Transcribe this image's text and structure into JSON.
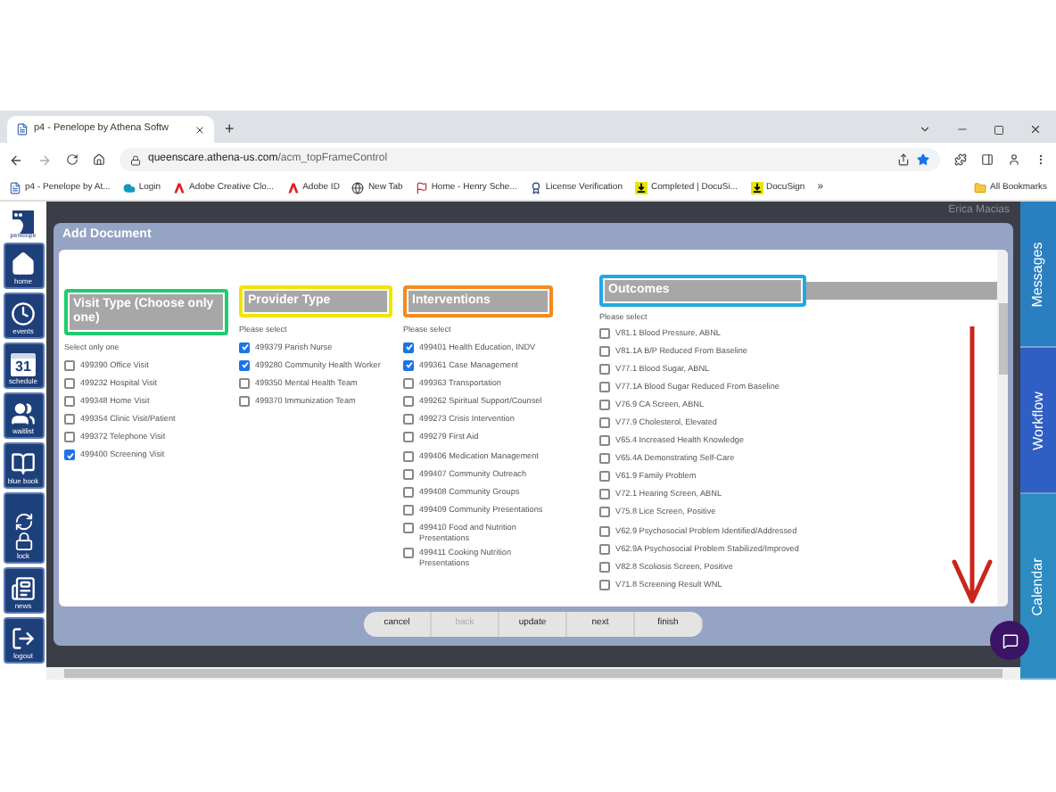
{
  "browser": {
    "tab_title": "p4 - Penelope by Athena Softw",
    "new_tab": "+",
    "address_host": "queenscare.athena-us.com",
    "address_path": "/acm_topFrameControl",
    "bookmarks": [
      {
        "label": "p4 - Penelope by At...",
        "kind": "page"
      },
      {
        "label": "Login",
        "kind": "cloud"
      },
      {
        "label": "Adobe Creative Clo...",
        "kind": "adobe"
      },
      {
        "label": "Adobe ID",
        "kind": "adobe"
      },
      {
        "label": "New Tab",
        "kind": "globe"
      },
      {
        "label": "Home - Henry Sche...",
        "kind": "flag"
      },
      {
        "label": "License Verification",
        "kind": "seal"
      },
      {
        "label": "Completed | DocuSi...",
        "kind": "download"
      },
      {
        "label": "DocuSign",
        "kind": "download"
      }
    ],
    "more": "»",
    "all_bookmarks": "All Bookmarks"
  },
  "sidebar": {
    "logo_label": "penelope",
    "items": [
      {
        "label": "home",
        "kind": "home"
      },
      {
        "label": "events",
        "kind": "clock"
      },
      {
        "label": "schedule",
        "kind": "calendar",
        "badge": "31"
      },
      {
        "label": "waitlist",
        "kind": "people"
      },
      {
        "label": "blue book",
        "kind": "book"
      },
      {
        "label": "lock",
        "kind": "lock"
      },
      {
        "label": "news",
        "kind": "news"
      },
      {
        "label": "logout",
        "kind": "logout"
      }
    ]
  },
  "user_name": "Erica Macias",
  "dialog": {
    "title": "Add Document",
    "sections": [
      {
        "title": "Visit Type (Choose only one)",
        "color": "#1fcc6e",
        "hint": "Select only one",
        "items": [
          {
            "label": "499390 Office Visit",
            "checked": false
          },
          {
            "label": "499232 Hospital Visit",
            "checked": false
          },
          {
            "label": "499348 Home Visit",
            "checked": false
          },
          {
            "label": "499354 Clinic Visit/Patient",
            "checked": false
          },
          {
            "label": "499372 Telephone Visit",
            "checked": false
          },
          {
            "label": "499400 Screening Visit",
            "checked": true
          }
        ]
      },
      {
        "title": "Provider Type",
        "color": "#f2e400",
        "hint": "Please select",
        "items": [
          {
            "label": "499379 Parish Nurse",
            "checked": true
          },
          {
            "label": "499280 Community Health Worker",
            "checked": true
          },
          {
            "label": "499350 Mental Health Team",
            "checked": false
          },
          {
            "label": "499370 Immunization Team",
            "checked": false
          }
        ]
      },
      {
        "title": "Interventions",
        "color": "#f38b1e",
        "hint": "Please select",
        "items": [
          {
            "label": "499401 Health Education, INDV",
            "checked": true
          },
          {
            "label": "499361 Case Management",
            "checked": true
          },
          {
            "label": "499363 Transportation",
            "checked": false
          },
          {
            "label": "499262 Spiritual Support/Counsel",
            "checked": false
          },
          {
            "label": "499273 Crisis Intervention",
            "checked": false
          },
          {
            "label": "499279 First Aid",
            "checked": false
          },
          {
            "label": "499406 Medication Management",
            "checked": false
          },
          {
            "label": "499407 Community Outreach",
            "checked": false
          },
          {
            "label": "499408 Community Groups",
            "checked": false
          },
          {
            "label": "499409 Community Presentations",
            "checked": false
          },
          {
            "label": "499410 Food and Nutrition Presentations",
            "checked": false
          },
          {
            "label": "499411 Cooking Nutrition Presentations",
            "checked": false
          }
        ]
      },
      {
        "title": "Outcomes",
        "color": "#22a9e2",
        "hint": "Please select",
        "items": [
          {
            "label": "V81.1 Blood Pressure, ABNL",
            "checked": false
          },
          {
            "label": "V81.1A B/P Reduced From Baseline",
            "checked": false
          },
          {
            "label": "V77.1 Blood Sugar, ABNL",
            "checked": false
          },
          {
            "label": "V77.1A Blood Sugar Reduced From Baseline",
            "checked": false
          },
          {
            "label": "V76.9 CA Screen, ABNL",
            "checked": false
          },
          {
            "label": "V77.9 Cholesterol, Elevated",
            "checked": false
          },
          {
            "label": "V65.4 Increased Health Knowledge",
            "checked": false
          },
          {
            "label": "V65.4A Demonstrating Self-Care",
            "checked": false
          },
          {
            "label": "V61.9 Family Problem",
            "checked": false
          },
          {
            "label": "V72.1 Hearing Screen, ABNL",
            "checked": false
          },
          {
            "label": "V75.8 Lice Screen, Positive",
            "checked": false
          },
          {
            "label": "V62.9 Psychosocial Problem Identified/Addressed",
            "checked": false
          },
          {
            "label": "V62.9A Psychosocial Problem Stabilized/Improved",
            "checked": false
          },
          {
            "label": "V82.8 Scoliosis Screen, Positive",
            "checked": false
          },
          {
            "label": "V71.8 Screening Result WNL",
            "checked": false
          }
        ]
      }
    ]
  },
  "buttons": [
    {
      "label": "cancel",
      "disabled": false
    },
    {
      "label": "back",
      "disabled": true
    },
    {
      "label": "update",
      "disabled": false
    },
    {
      "label": "next",
      "disabled": false
    },
    {
      "label": "finish",
      "disabled": false
    }
  ],
  "right_tabs": [
    {
      "label": "Messages",
      "color": "#2a7fc0"
    },
    {
      "label": "Workflow",
      "color": "#2f5fc4"
    },
    {
      "label": "Calendar",
      "color": "#2c8bc0"
    }
  ]
}
